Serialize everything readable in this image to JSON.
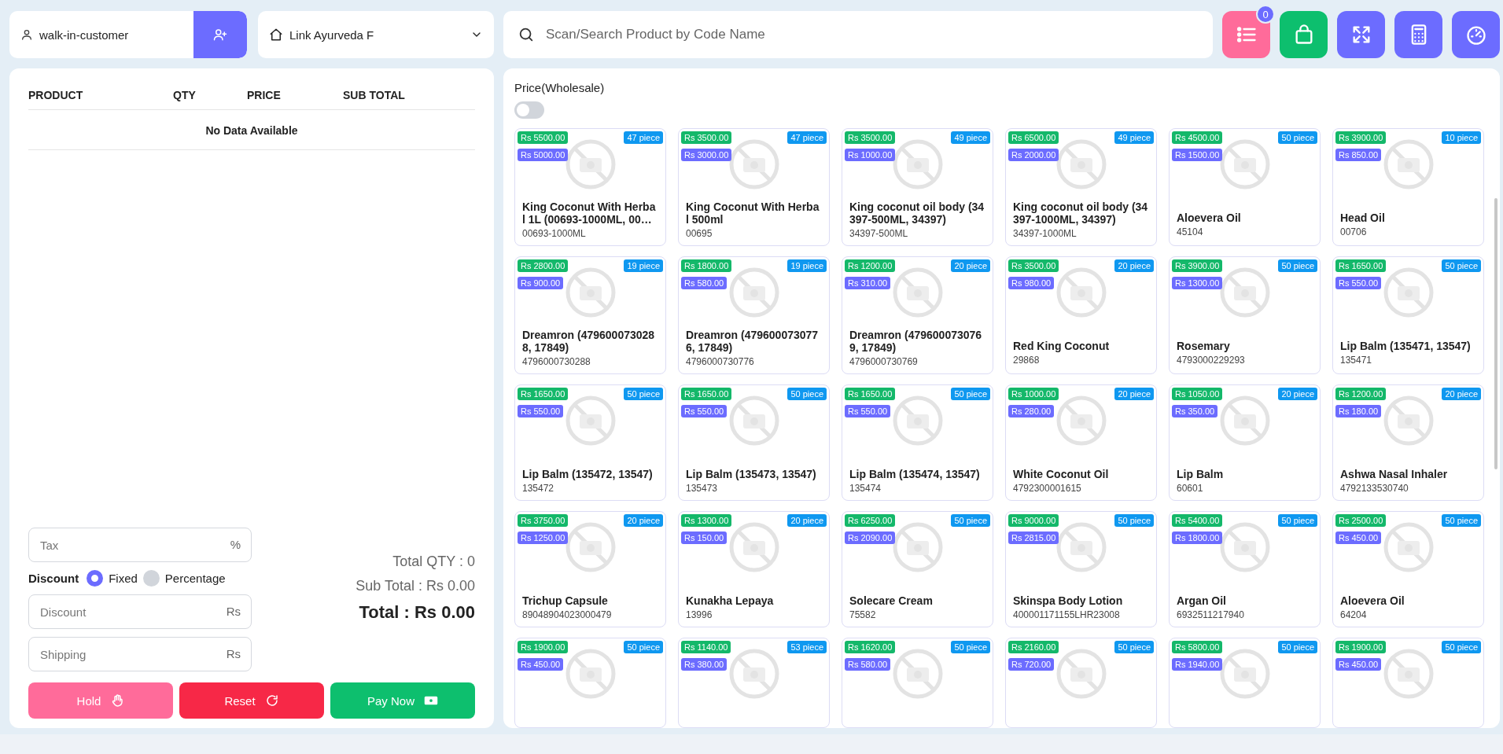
{
  "customer": {
    "value": "walk-in-customer"
  },
  "warehouse": {
    "value": "Link Ayurveda F"
  },
  "search": {
    "placeholder": "Scan/Search Product by Code Name"
  },
  "toolbar": [
    {
      "kind": "list",
      "badge": "0"
    },
    {
      "kind": "bag"
    },
    {
      "kind": "fullscreen"
    },
    {
      "kind": "calculator"
    },
    {
      "kind": "dashboard"
    }
  ],
  "cart": {
    "columns": [
      "PRODUCT",
      "QTY",
      "PRICE",
      "SUB TOTAL"
    ],
    "empty_text": "No Data Available"
  },
  "tax": {
    "placeholder": "Tax",
    "suffix": "%"
  },
  "discount_type": {
    "label": "Discount",
    "options": [
      {
        "label": "Fixed",
        "selected": true
      },
      {
        "label": "Percentage",
        "selected": false
      }
    ]
  },
  "discount": {
    "placeholder": "Discount",
    "suffix": "Rs"
  },
  "shipping": {
    "placeholder": "Shipping",
    "suffix": "Rs"
  },
  "totals": {
    "qty": "Total QTY : 0",
    "sub_total": "Sub Total : Rs 0.00",
    "total": "Total : Rs 0.00"
  },
  "actions": [
    {
      "kind": "hold",
      "label": "Hold"
    },
    {
      "kind": "reset",
      "label": "Reset"
    },
    {
      "kind": "pay",
      "label": "Pay Now"
    }
  ],
  "price_toggle": {
    "label": "Price(Wholesale)",
    "on": false
  },
  "products": [
    {
      "price": "Rs 5500.00",
      "cost": "Rs 5000.00",
      "stock": "47 piece",
      "name": "King Coconut With Herbal 1L (00693-1000ML, 00…",
      "code": "00693-1000ML"
    },
    {
      "price": "Rs 3500.00",
      "cost": "Rs 3000.00",
      "stock": "47 piece",
      "name": "King Coconut With Herbal 500ml",
      "code": "00695"
    },
    {
      "price": "Rs 3500.00",
      "cost": "Rs 1000.00",
      "stock": "49 piece",
      "name": "King coconut oil body (34397-500ML, 34397)",
      "code": "34397-500ML"
    },
    {
      "price": "Rs 6500.00",
      "cost": "Rs 2000.00",
      "stock": "49 piece",
      "name": "King coconut oil body (34397-1000ML, 34397)",
      "code": "34397-1000ML"
    },
    {
      "price": "Rs 4500.00",
      "cost": "Rs 1500.00",
      "stock": "50 piece",
      "name": "Aloevera Oil",
      "code": "45104"
    },
    {
      "price": "Rs 3900.00",
      "cost": "Rs 850.00",
      "stock": "10 piece",
      "name": "Head Oil",
      "code": "00706"
    },
    {
      "price": "Rs 2800.00",
      "cost": "Rs 900.00",
      "stock": "19 piece",
      "name": "Dreamron (4796000730288, 17849)",
      "code": "4796000730288"
    },
    {
      "price": "Rs 1800.00",
      "cost": "Rs 580.00",
      "stock": "19 piece",
      "name": "Dreamron (4796000730776, 17849)",
      "code": "4796000730776"
    },
    {
      "price": "Rs 1200.00",
      "cost": "Rs 310.00",
      "stock": "20 piece",
      "name": "Dreamron (4796000730769, 17849)",
      "code": "4796000730769"
    },
    {
      "price": "Rs 3500.00",
      "cost": "Rs 980.00",
      "stock": "20 piece",
      "name": "Red King Coconut",
      "code": "29868"
    },
    {
      "price": "Rs 3900.00",
      "cost": "Rs 1300.00",
      "stock": "50 piece",
      "name": "Rosemary",
      "code": "4793000229293"
    },
    {
      "price": "Rs 1650.00",
      "cost": "Rs 550.00",
      "stock": "50 piece",
      "name": "Lip Balm (135471, 13547)",
      "code": "135471"
    },
    {
      "price": "Rs 1650.00",
      "cost": "Rs 550.00",
      "stock": "50 piece",
      "name": "Lip Balm (135472, 13547)",
      "code": "135472"
    },
    {
      "price": "Rs 1650.00",
      "cost": "Rs 550.00",
      "stock": "50 piece",
      "name": "Lip Balm (135473, 13547)",
      "code": "135473"
    },
    {
      "price": "Rs 1650.00",
      "cost": "Rs 550.00",
      "stock": "50 piece",
      "name": "Lip Balm (135474, 13547)",
      "code": "135474"
    },
    {
      "price": "Rs 1000.00",
      "cost": "Rs 280.00",
      "stock": "20 piece",
      "name": "White Coconut Oil",
      "code": "4792300001615"
    },
    {
      "price": "Rs 1050.00",
      "cost": "Rs 350.00",
      "stock": "20 piece",
      "name": "Lip Balm",
      "code": "60601"
    },
    {
      "price": "Rs 1200.00",
      "cost": "Rs 180.00",
      "stock": "20 piece",
      "name": "Ashwa Nasal Inhaler",
      "code": "4792133530740"
    },
    {
      "price": "Rs 3750.00",
      "cost": "Rs 1250.00",
      "stock": "20 piece",
      "name": "Trichup Capsule",
      "code": "89048904023000479"
    },
    {
      "price": "Rs 1300.00",
      "cost": "Rs 150.00",
      "stock": "20 piece",
      "name": "Kunakha Lepaya",
      "code": "13996"
    },
    {
      "price": "Rs 6250.00",
      "cost": "Rs 2090.00",
      "stock": "50 piece",
      "name": "Solecare Cream",
      "code": "75582"
    },
    {
      "price": "Rs 9000.00",
      "cost": "Rs 2815.00",
      "stock": "50 piece",
      "name": "Skinspa Body Lotion",
      "code": "400001171155LHR23008"
    },
    {
      "price": "Rs 5400.00",
      "cost": "Rs 1800.00",
      "stock": "50 piece",
      "name": "Argan Oil",
      "code": "6932511217940"
    },
    {
      "price": "Rs 2500.00",
      "cost": "Rs 450.00",
      "stock": "50 piece",
      "name": "Aloevera Oil",
      "code": "64204"
    },
    {
      "price": "Rs 1900.00",
      "cost": "Rs 450.00",
      "stock": "50 piece"
    },
    {
      "price": "Rs 1140.00",
      "cost": "Rs 380.00",
      "stock": "53 piece"
    },
    {
      "price": "Rs 1620.00",
      "cost": "Rs 580.00",
      "stock": "50 piece"
    },
    {
      "price": "Rs 2160.00",
      "cost": "Rs 720.00",
      "stock": "50 piece"
    },
    {
      "price": "Rs 5800.00",
      "cost": "Rs 1940.00",
      "stock": "50 piece"
    },
    {
      "price": "Rs 1900.00",
      "cost": "Rs 450.00",
      "stock": "50 piece"
    }
  ]
}
